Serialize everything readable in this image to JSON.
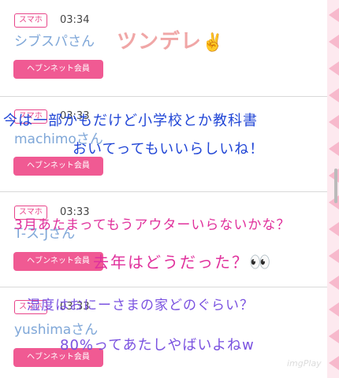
{
  "entries": [
    {
      "device": "スマホ",
      "time": "03:34",
      "user": "シブスパさん",
      "member_label": "ヘブンネット会員"
    },
    {
      "device": "スマホ",
      "time": "03:33",
      "user": "machimoさん",
      "member_label": "ヘブンネット会員"
    },
    {
      "device": "スマホ",
      "time": "03:33",
      "user": "T-ス-Jさん",
      "member_label": "ヘブンネット会員"
    },
    {
      "device": "スマホ",
      "time": "03:33",
      "user": "yushimaさん",
      "member_label": "ヘブンネット会員"
    }
  ],
  "overlay_text": {
    "line1": "ツンデレ",
    "line2": "今は一部かもだけど小学校とか教科書",
    "line3": "おいてってもいいらしいね！",
    "line4": "3月あたまってもうアウターいらないかな？",
    "line5": "去年はどうだった？",
    "line6": "湿度はおにーさまの家どのぐらい？",
    "line7": "80%ってあたしやばいよねw",
    "emoji_victory": "✌️",
    "emoji_eyes": "👀"
  },
  "watermark": "imgPlay",
  "colors": {
    "accent": "#f05a93",
    "username": "#7fa7d8",
    "overlay_blue": "#2146d6",
    "overlay_pink": "#e0319c",
    "overlay_purple": "#7a52e0"
  }
}
